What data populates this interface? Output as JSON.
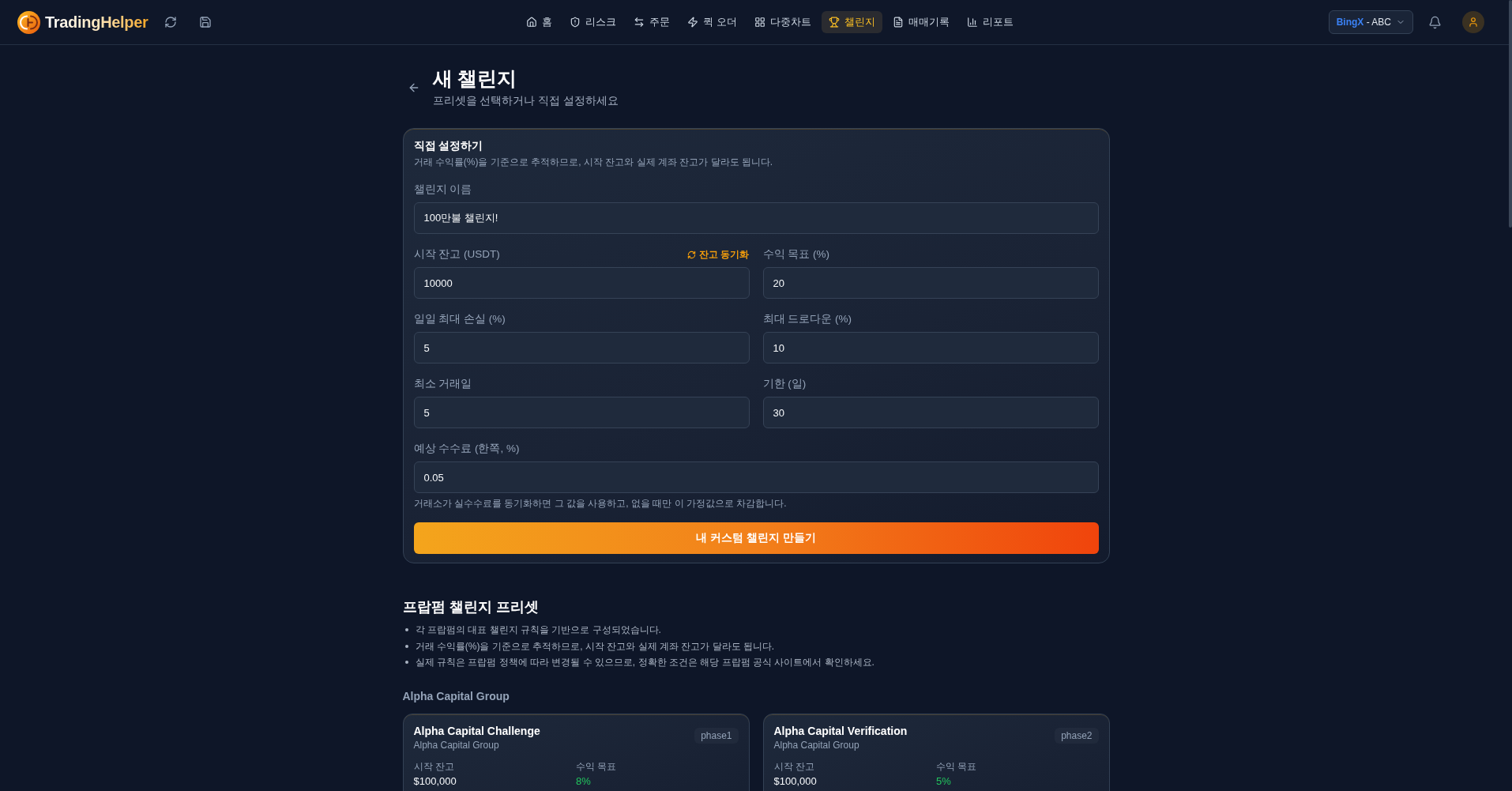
{
  "app": {
    "name": "TradingHelper"
  },
  "nav": {
    "items": [
      {
        "label": "홈",
        "selected": false
      },
      {
        "label": "리스크",
        "selected": false
      },
      {
        "label": "주문",
        "selected": false
      },
      {
        "label": "퀵 오더",
        "selected": false
      },
      {
        "label": "다중차트",
        "selected": false
      },
      {
        "label": "챌린지",
        "selected": true
      },
      {
        "label": "매매기록",
        "selected": false
      },
      {
        "label": "리포트",
        "selected": false
      }
    ]
  },
  "account": {
    "exchange": "BingX",
    "name": "- ABC"
  },
  "header": {
    "title": "새 챌린지",
    "subtitle": "프리셋을 선택하거나 직접 설정하세요"
  },
  "custom_form": {
    "title": "직접 설정하기",
    "description": "거래 수익률(%)을 기준으로 추적하므로, 시작 잔고와 실제 계좌 잔고가 달라도 됩니다.",
    "fields": [
      {
        "kind": "wide",
        "label": "챌린지 이름",
        "value": "100만불 챌린지!"
      },
      {
        "kind": "half",
        "label": "시작 잔고 (USDT)",
        "value": "10000",
        "action": "잔고 동기화"
      },
      {
        "kind": "half",
        "label": "수익 목표 (%)",
        "value": "20"
      },
      {
        "kind": "half",
        "label": "일일 최대 손실 (%)",
        "value": "5"
      },
      {
        "kind": "half",
        "label": "최대 드로다운 (%)",
        "value": "10"
      },
      {
        "kind": "half",
        "label": "최소 거래일",
        "value": "5"
      },
      {
        "kind": "half",
        "label": "기한 (일)",
        "value": "30"
      },
      {
        "kind": "wide",
        "label": "예상 수수료 (한쪽, %)",
        "value": "0.05",
        "hint": "거래소가 실수수료를 동기화하면 그 값을 사용하고, 없을 때만 이 가정값으로 차감합니다."
      }
    ],
    "submit": "내 커스텀 챌린지 만들기"
  },
  "presets": {
    "title": "프랍펌 챌린지 프리셋",
    "notes": [
      "각 프랍펌의 대표 챌린지 규칙을 기반으로 구성되었습니다.",
      "거래 수익률(%)을 기준으로 추적하므로, 시작 잔고와 실제 계좌 잔고가 달라도 됩니다.",
      "실제 규칙은 프랍펌 정책에 따라 변경될 수 있으므로, 정확한 조건은 해당 프랍펌 공식 사이트에서 확인하세요."
    ],
    "groups": [
      {
        "name": "Alpha Capital Group",
        "cards": [
          {
            "title": "Alpha Capital Challenge",
            "firm": "Alpha Capital Group",
            "phase": "phase1",
            "stats": [
              {
                "kind": "plain",
                "label": "시작 잔고",
                "value": "$100,000"
              },
              {
                "kind": "positive",
                "label": "수익 목표",
                "value": "8%"
              }
            ]
          },
          {
            "title": "Alpha Capital Verification",
            "firm": "Alpha Capital Group",
            "phase": "phase2",
            "stats": [
              {
                "kind": "plain",
                "label": "시작 잔고",
                "value": "$100,000"
              },
              {
                "kind": "positive",
                "label": "수익 목표",
                "value": "5%"
              }
            ]
          }
        ]
      }
    ]
  }
}
